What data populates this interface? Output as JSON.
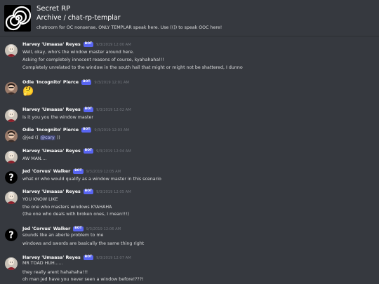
{
  "header": {
    "server_name": "Secret RP",
    "channel_path": "Archive / chat-rp-templar",
    "topic": "chatroom for OC nonsense. ONLY TEMPLAR speak here. Use (()) to speak OOC here!"
  },
  "bot_label": "BOT",
  "messages": [
    {
      "author": "Harvey 'Umaasa' Reyes",
      "timestamp": "9/3/2019 12:00 AM",
      "lines": [
        "Well, okay, who's the window master around here.",
        "Asking for completely innocent reasons of course, kyahahaha!!!",
        "Completely unrelated to the window in the south hall that might or might not be shattered, I dunno"
      ]
    },
    {
      "author": "Odie 'Incognito' Pierce",
      "timestamp": "9/3/2019 12:01 AM",
      "emoji": "🤔",
      "emoji_name": "thinking-face"
    },
    {
      "author": "Harvey 'Umaasa' Reyes",
      "timestamp": "9/3/2019 12:02 AM",
      "lines": [
        "Is it you you the window master"
      ]
    },
    {
      "author": "Odie 'Incognito' Pierce",
      "timestamp": "9/3/2019 12:03 AM",
      "line_prefix": "@jed ((",
      "mention": "@cory",
      "line_suffix": "))"
    },
    {
      "author": "Harvey 'Umaasa' Reyes",
      "timestamp": "9/3/2019 12:04 AM",
      "lines": [
        "AW MAN...."
      ]
    },
    {
      "author": "Jed 'Corvus' Walker",
      "timestamp": "9/3/2019 12:05 AM",
      "lines": [
        "what or who would qualify as a window master in this scenario"
      ]
    },
    {
      "author": "Harvey 'Umaasa' Reyes",
      "timestamp": "9/3/2019 12:05 AM",
      "lines": [
        "YOU KNOW LIKE",
        "the one who masters windows KYAHAHA",
        "(the one who deals with broken ones, I mean!!!)"
      ]
    },
    {
      "author": "Jed 'Corvus' Walker",
      "timestamp": "9/3/2019 12:06 AM",
      "lines": [
        "sounds like an aberle problem to me",
        "windows and swords are basically the same thing right"
      ]
    },
    {
      "author": "Harvey 'Umaasa' Reyes",
      "timestamp": "9/3/2019 12:07 AM",
      "lines": [
        "MR TOAD HUH......",
        "they really arent hahahaha!!!",
        "oh man jed have you never seen a window before!???!"
      ]
    }
  ],
  "colors": {
    "background": "#36393f",
    "bot_badge": "#5865f2",
    "username": "#ffffff",
    "text": "#dcddde",
    "timestamp": "#72767d",
    "mention_bg": "#414675"
  }
}
